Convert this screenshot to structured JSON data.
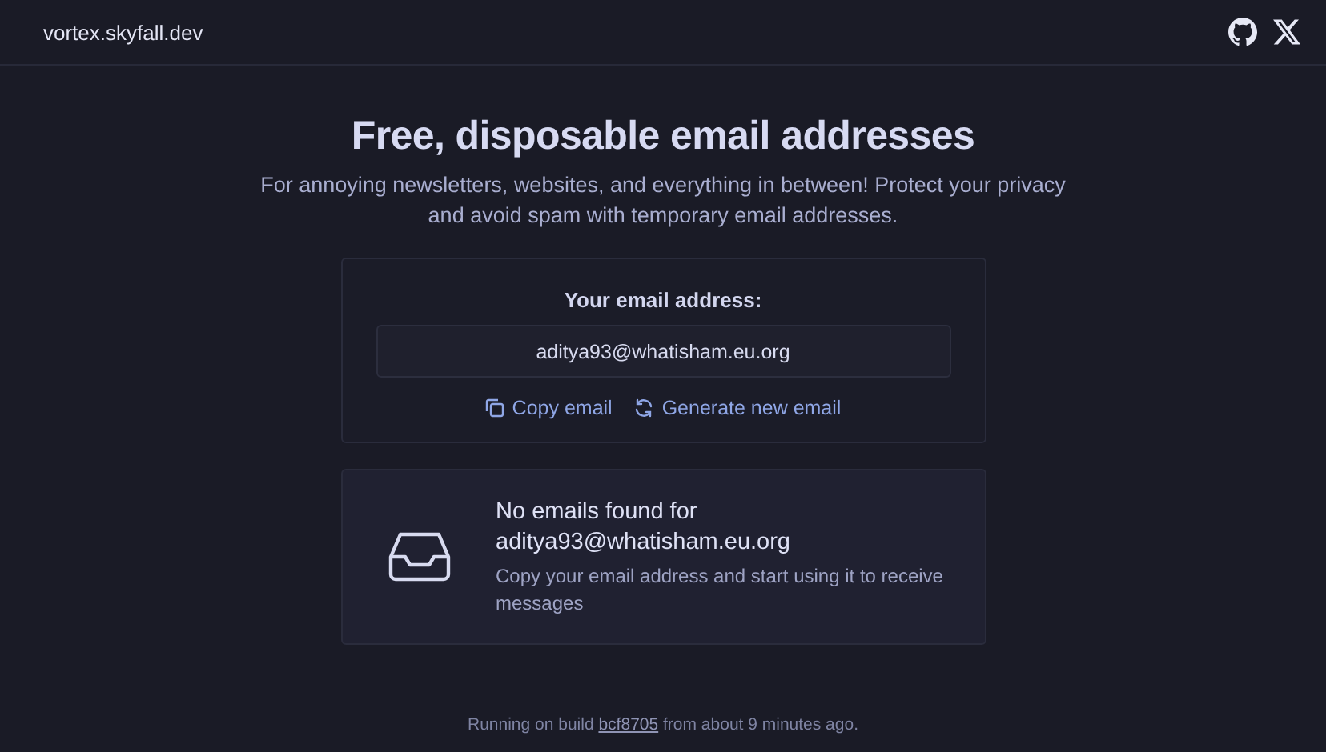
{
  "header": {
    "site_name": "vortex.skyfall.dev",
    "links": [
      {
        "kind": "github"
      },
      {
        "kind": "x"
      }
    ]
  },
  "hero": {
    "title": "Free, disposable email addresses",
    "subtitle": "For annoying newsletters, websites, and everything in between! Protect your privacy and avoid spam with temporary email addresses."
  },
  "email_card": {
    "label": "Your email address:",
    "address": "aditya93@whatisham.eu.org",
    "actions": [
      {
        "kind": "copy",
        "label": "Copy email"
      },
      {
        "kind": "refresh",
        "label": "Generate new email"
      }
    ]
  },
  "inbox": {
    "title": "No emails found for aditya93@whatisham.eu.org",
    "message": "Copy your email address and start using it to receive messages"
  },
  "footer": {
    "prefix": "Running on build",
    "build": "bcf8705",
    "suffix": "from about 9 minutes ago."
  }
}
